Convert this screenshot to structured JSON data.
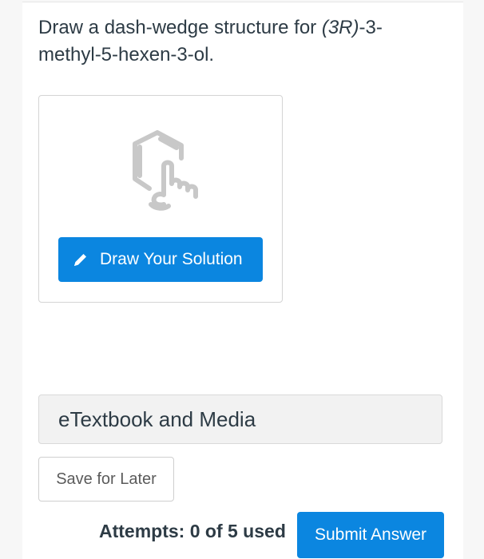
{
  "question": {
    "prefix": "Draw a dash-wedge structure for ",
    "italic": "(3R)",
    "suffix": "-3-methyl-5-hexen-3-ol."
  },
  "draw_card": {
    "icon": "hexagon-hand-icon",
    "button_icon": "pencil-icon",
    "button_label": "Draw Your Solution"
  },
  "etextbook": {
    "label": "eTextbook and Media"
  },
  "actions": {
    "save_label": "Save for Later",
    "attempts_text": "Attempts: 0 of 5 used",
    "submit_label": "Submit Answer"
  },
  "colors": {
    "accent": "#0b86e0",
    "icon_gray": "#c8c8c8"
  }
}
